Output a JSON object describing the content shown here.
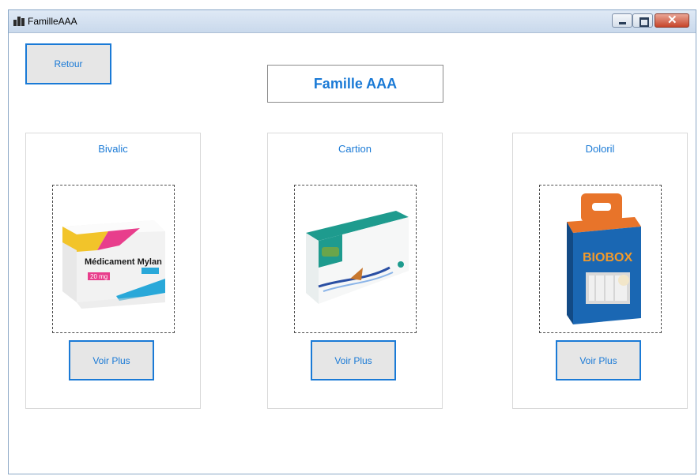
{
  "window": {
    "title": "FamilleAAA"
  },
  "page": {
    "heading": "Famille AAA",
    "back_label": "Retour"
  },
  "products": [
    {
      "name": "Bivalic",
      "button": "Voir Plus",
      "image": "medicament-box",
      "box_text": "Médicament Mylan",
      "dose": "20 mg"
    },
    {
      "name": "Cartion",
      "button": "Voir Plus",
      "image": "teal-product-box"
    },
    {
      "name": "Doloril",
      "button": "Voir Plus",
      "image": "biobox-package",
      "box_text": "BIOBOX"
    }
  ],
  "colors": {
    "accent": "#1a7ad6",
    "button_bg": "#e6e6e6"
  }
}
